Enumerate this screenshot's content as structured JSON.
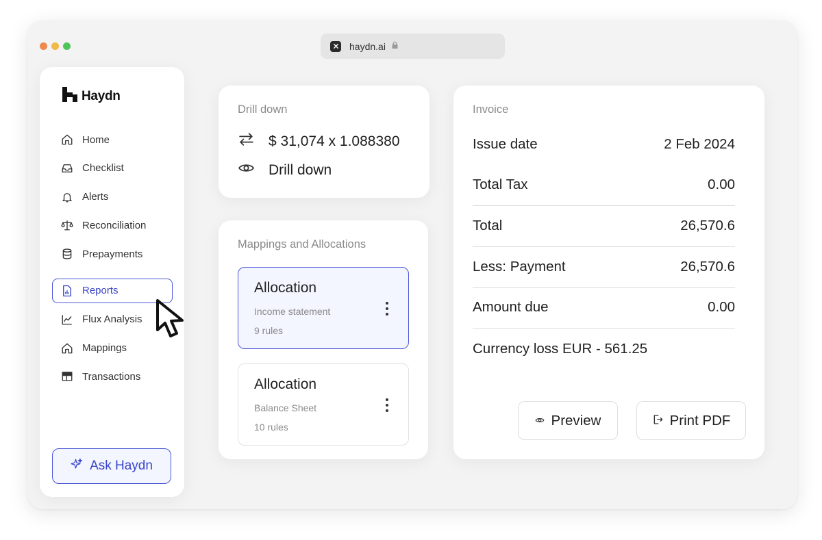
{
  "browser": {
    "url": "haydn.ai",
    "dot_colors": [
      "#ee8a4f",
      "#f1b948",
      "#4fc45a"
    ]
  },
  "sidebar": {
    "logo": "Haydn",
    "items": [
      {
        "label": "Home",
        "icon": "home-icon"
      },
      {
        "label": "Checklist",
        "icon": "inbox-icon"
      },
      {
        "label": "Alerts",
        "icon": "bell-icon"
      },
      {
        "label": "Reconciliation",
        "icon": "scale-icon"
      },
      {
        "label": "Prepayments",
        "icon": "database-icon"
      },
      {
        "label": "Reports",
        "icon": "report-icon",
        "active": true
      },
      {
        "label": "Flux Analysis",
        "icon": "chart-icon"
      },
      {
        "label": "Mappings",
        "icon": "home-icon"
      },
      {
        "label": "Transactions",
        "icon": "table-icon"
      }
    ],
    "ask_button": "Ask Haydn"
  },
  "drill_down": {
    "title": "Drill down",
    "conversion": "$ 31,074 x 1.088380",
    "action": "Drill down"
  },
  "mappings": {
    "title": "Mappings and Allocations",
    "allocations": [
      {
        "title": "Allocation",
        "subtitle": "Income statement",
        "rules": "9 rules",
        "selected": true
      },
      {
        "title": "Allocation",
        "subtitle": "Balance Sheet",
        "rules": "10 rules",
        "selected": false
      }
    ]
  },
  "invoice": {
    "title": "Invoice",
    "rows": [
      {
        "label": "Issue date",
        "value": "2 Feb 2024"
      },
      {
        "label": "Total Tax",
        "value": "0.00"
      },
      {
        "label": "Total",
        "value": "26,570.6"
      },
      {
        "label": "Less: Payment",
        "value": "26,570.6"
      },
      {
        "label": "Amount due",
        "value": "0.00"
      }
    ],
    "currency_note": "Currency loss EUR - 561.25",
    "preview_button": "Preview",
    "print_button": "Print PDF"
  },
  "colors": {
    "accent": "#4a55d6",
    "accent_bg": "#f3f5ff"
  }
}
